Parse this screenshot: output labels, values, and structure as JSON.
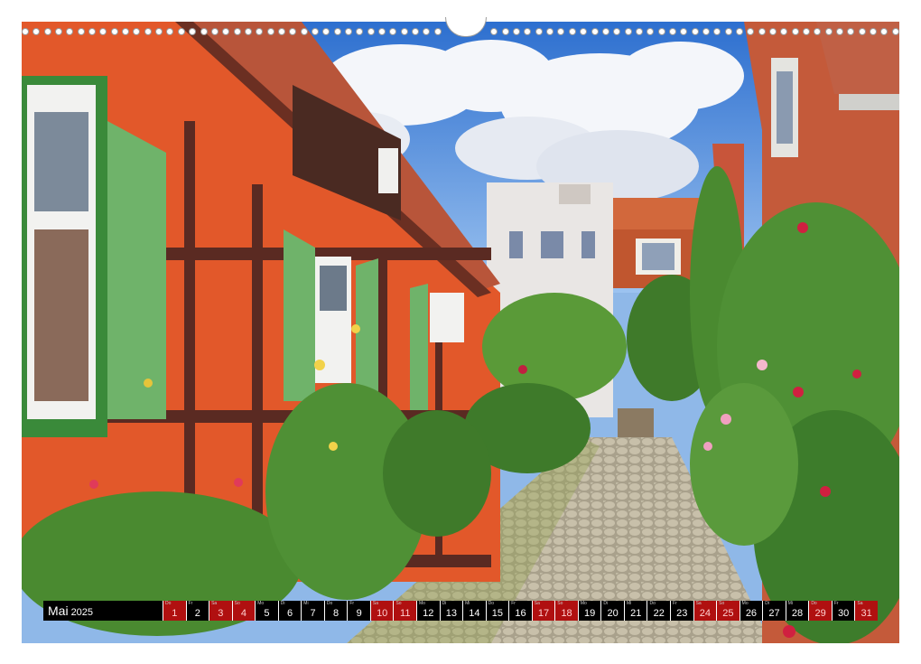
{
  "photo": {
    "subject": ""
  },
  "calendar": {
    "month": "Mai",
    "year": "2025",
    "days": [
      {
        "wd": "Do",
        "n": "1",
        "holiday": true
      },
      {
        "wd": "Fr",
        "n": "2",
        "holiday": false
      },
      {
        "wd": "Sa",
        "n": "3",
        "holiday": true
      },
      {
        "wd": "So",
        "n": "4",
        "holiday": true
      },
      {
        "wd": "Mo",
        "n": "5",
        "holiday": false
      },
      {
        "wd": "Di",
        "n": "6",
        "holiday": false
      },
      {
        "wd": "Mi",
        "n": "7",
        "holiday": false
      },
      {
        "wd": "Do",
        "n": "8",
        "holiday": false
      },
      {
        "wd": "Fr",
        "n": "9",
        "holiday": false
      },
      {
        "wd": "Sa",
        "n": "10",
        "holiday": true
      },
      {
        "wd": "So",
        "n": "11",
        "holiday": true
      },
      {
        "wd": "Mo",
        "n": "12",
        "holiday": false
      },
      {
        "wd": "Di",
        "n": "13",
        "holiday": false
      },
      {
        "wd": "Mi",
        "n": "14",
        "holiday": false
      },
      {
        "wd": "Do",
        "n": "15",
        "holiday": false
      },
      {
        "wd": "Fr",
        "n": "16",
        "holiday": false
      },
      {
        "wd": "Sa",
        "n": "17",
        "holiday": true
      },
      {
        "wd": "So",
        "n": "18",
        "holiday": true
      },
      {
        "wd": "Mo",
        "n": "19",
        "holiday": false
      },
      {
        "wd": "Di",
        "n": "20",
        "holiday": false
      },
      {
        "wd": "Mi",
        "n": "21",
        "holiday": false
      },
      {
        "wd": "Do",
        "n": "22",
        "holiday": false
      },
      {
        "wd": "Fr",
        "n": "23",
        "holiday": false
      },
      {
        "wd": "Sa",
        "n": "24",
        "holiday": true
      },
      {
        "wd": "So",
        "n": "25",
        "holiday": true
      },
      {
        "wd": "Mo",
        "n": "26",
        "holiday": false
      },
      {
        "wd": "Di",
        "n": "27",
        "holiday": false
      },
      {
        "wd": "Mi",
        "n": "28",
        "holiday": false
      },
      {
        "wd": "Do",
        "n": "29",
        "holiday": true
      },
      {
        "wd": "Fr",
        "n": "30",
        "holiday": false
      },
      {
        "wd": "Sa",
        "n": "31",
        "holiday": true
      }
    ]
  },
  "colors": {
    "holiday_bg": "#b01010",
    "strip_bg": "#000000",
    "facade_orange": "#e2582a",
    "shutter_green": "#6fb36a",
    "sky_blue": "#3f7fd6"
  }
}
